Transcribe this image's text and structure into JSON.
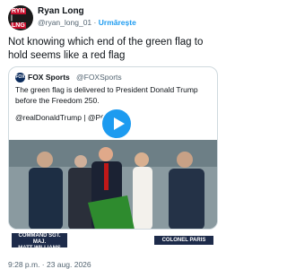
{
  "author": {
    "avatar_text": [
      "RYN",
      "LNG"
    ],
    "name": "Ryan Long",
    "handle": "@ryan_long_01",
    "separator": "·",
    "follow_label": "Urmărește"
  },
  "tweet_text": "Not knowing which end of the green flag to hold seems like a red flag",
  "quoted": {
    "logo_text": "FOX",
    "name": "FOX Sports",
    "handle": "@FOXSports",
    "text": "The green flag is delivered to President Donald Trump before the Freedom 250.",
    "mentions": "@realDonaldTrump | @POTUS",
    "media": {
      "caption_left_line1": "COMMAND SGT. MAJ.",
      "caption_left_line2": "MATT WILLIAMS",
      "caption_right": "COLONEL PARIS DAVIS"
    }
  },
  "timestamp": "9:28 p.m. · 23 aug. 2026",
  "colors": {
    "link_blue": "#1d9bf0",
    "secondary_text": "#536471",
    "border": "#cfd9de",
    "fox_navy": "#0a2b5c",
    "flag_green": "#2e8b2e"
  }
}
